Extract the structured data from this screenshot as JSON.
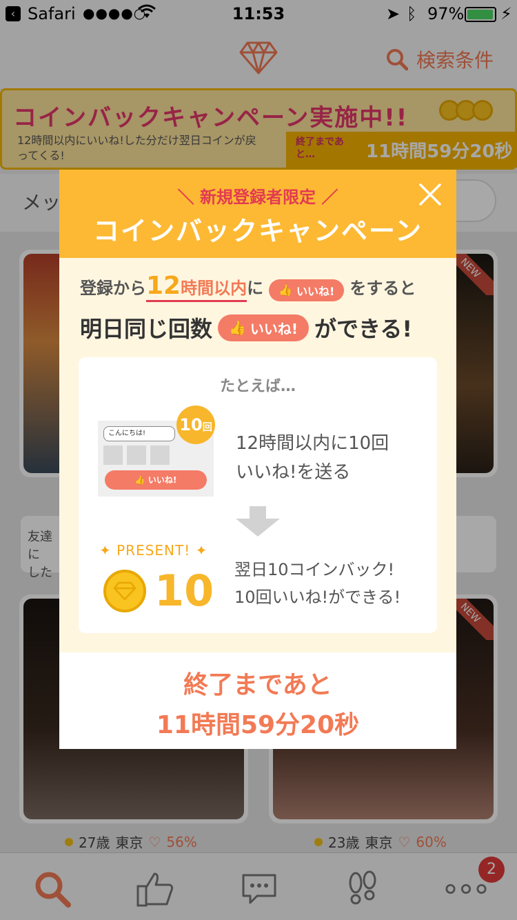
{
  "status_bar": {
    "carrier": "Safari",
    "signal": "●●●●○",
    "time": "11:53",
    "battery": "97%",
    "battery_level": 0.97
  },
  "header": {
    "search_label": "検索条件"
  },
  "banner": {
    "title": "コインバックキャンペーン実施中!!",
    "subtitle": "12時間以内にいいね!した分だけ翌日コインが戻ってくる!",
    "timer_label": "終了まであと…",
    "timer": "11時間59分20秒"
  },
  "background": {
    "toggle_label": "メッ",
    "new_badge": "NEW",
    "friend_text": "友達に した",
    "cards": [
      {
        "age": "27歳",
        "city": "東京",
        "rate": "56%"
      },
      {
        "age": "23歳",
        "city": "東京",
        "rate": "60%"
      }
    ]
  },
  "tabbar": {
    "badge_count": "2"
  },
  "modal": {
    "kicker": "＼ 新規登録者限定 ／",
    "title": "コインバックキャンペーン",
    "line1": {
      "pre": "登録から",
      "num": "12",
      "hl": "時間以内",
      "mid": "に",
      "pill": "いいね!",
      "post": "をすると"
    },
    "line2": {
      "pre": "明日同じ回数",
      "pill": "いいね!",
      "post": "ができる!"
    },
    "example": {
      "title": "たとえば…",
      "bubble_text": "こんにちは!",
      "button_text": "いいね!",
      "count": "10",
      "count_unit": "回",
      "step1_a": "12時間以内に10回",
      "step1_b": "いいね!を送る",
      "present": "✦ PRESENT! ✦",
      "coin_count": "10",
      "step2_a": "翌日10コインバック!",
      "step2_b": "10回いいね!ができる!"
    },
    "footer": {
      "line1": "終了まであと",
      "line2": "11時間59分20秒"
    }
  }
}
